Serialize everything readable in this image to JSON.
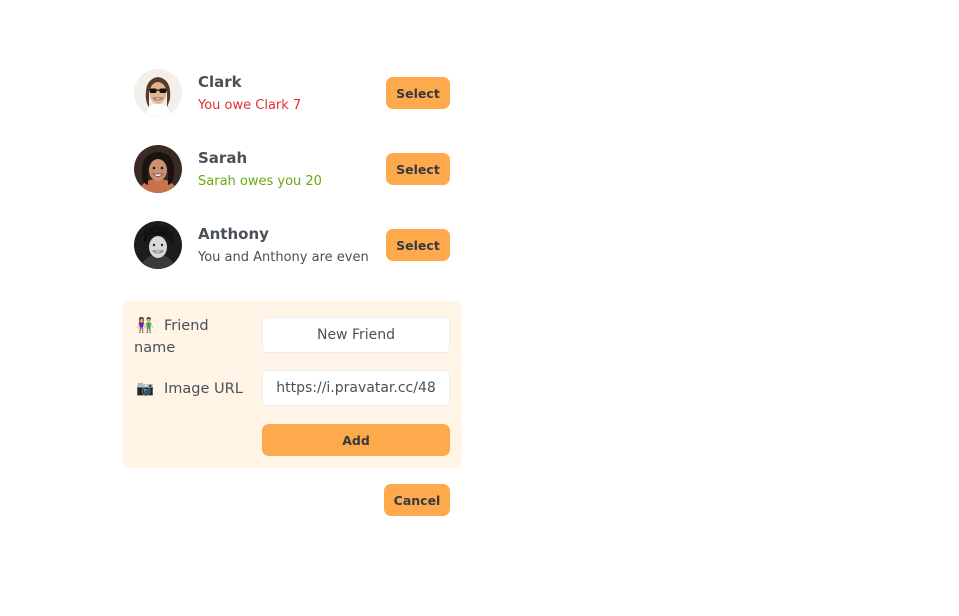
{
  "friends": [
    {
      "name": "Clark",
      "status": "You owe Clark 7",
      "status_type": "owe",
      "button": "Select"
    },
    {
      "name": "Sarah",
      "status": "Sarah owes you 20",
      "status_type": "owed",
      "button": "Select"
    },
    {
      "name": "Anthony",
      "status": "You and Anthony are even",
      "status_type": "even",
      "button": "Select"
    }
  ],
  "form": {
    "friend_name_label": "Friend name",
    "friend_name_icon": "👫",
    "friend_name_value": "New Friend",
    "image_url_label": "Image URL",
    "image_url_icon": "📷",
    "image_url_value": "https://i.pravatar.cc/48",
    "add_button": "Add"
  },
  "cancel_button": "Cancel",
  "colors": {
    "accent": "#ffa94d",
    "form_bg": "#fff4e6",
    "owe": "#e03131",
    "owed": "#66a80f",
    "text": "#495057"
  }
}
